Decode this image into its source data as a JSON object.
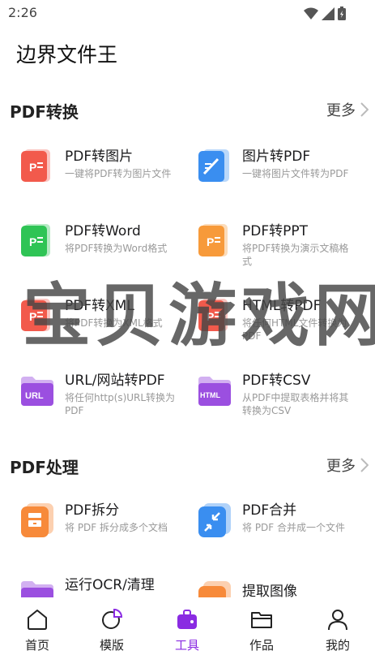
{
  "status": {
    "time": "2:26"
  },
  "app": {
    "title": "边界文件王"
  },
  "sections": [
    {
      "title": "PDF转换",
      "more": "更多",
      "tools": [
        {
          "name": "PDF转图片",
          "desc": "一键将PDF转为图片文件",
          "icon": "pdf-to-image-icon",
          "color": "#f25a4c",
          "badge": "P"
        },
        {
          "name": "图片转PDF",
          "desc": "一键将图片文件转为PDF",
          "icon": "image-to-pdf-icon",
          "color": "#3a8ef0",
          "badge": ""
        },
        {
          "name": "PDF转Word",
          "desc": "将PDF转换为Word格式",
          "icon": "pdf-to-word-icon",
          "color": "#2fc455",
          "badge": "P"
        },
        {
          "name": "PDF转PPT",
          "desc": "将PDF转换为演示文稿格式",
          "icon": "pdf-to-ppt-icon",
          "color": "#f79a3a",
          "badge": "P"
        },
        {
          "name": "PDF转XML",
          "desc": "将PDF转换为XML格式",
          "icon": "pdf-to-xml-icon",
          "color": "#f25a4c",
          "badge": "P"
        },
        {
          "name": "HTML转PDF",
          "desc": "将任何HTML文件转换为PDF",
          "icon": "html-to-pdf-icon",
          "color": "#f25a4c",
          "badge": "P"
        },
        {
          "name": "URL/网站转PDF",
          "desc": "将任何http(s)URL转换为PDF",
          "icon": "url-to-pdf-icon",
          "color": "#9b4fe0",
          "badge": "URL"
        },
        {
          "name": "PDF转CSV",
          "desc": "从PDF中提取表格并将其转换为CSV",
          "icon": "pdf-to-csv-icon",
          "color": "#9b4fe0",
          "badge": "HTML"
        }
      ]
    },
    {
      "title": "PDF处理",
      "more": "更多",
      "tools": [
        {
          "name": "PDF拆分",
          "desc": "将 PDF 拆分成多个文档",
          "icon": "pdf-split-icon",
          "color": "#f78a3a",
          "badge": ""
        },
        {
          "name": "PDF合并",
          "desc": "将 PDF 合并成一个文件",
          "icon": "pdf-merge-icon",
          "color": "#3a8ef0",
          "badge": ""
        },
        {
          "name": "运行OCR/清理",
          "desc": "",
          "icon": "ocr-icon",
          "color": "#9b4fe0",
          "badge": ""
        },
        {
          "name": "提取图像",
          "desc": "",
          "icon": "extract-image-icon",
          "color": "#f78a3a",
          "badge": ""
        }
      ]
    }
  ],
  "watermark": "宝贝游戏网",
  "tabs": [
    {
      "label": "首页",
      "icon": "home-icon"
    },
    {
      "label": "模版",
      "icon": "template-icon"
    },
    {
      "label": "工具",
      "icon": "toolbox-icon",
      "active": true
    },
    {
      "label": "作品",
      "icon": "folder-icon"
    },
    {
      "label": "我的",
      "icon": "user-icon"
    }
  ],
  "colors": {
    "accent": "#8a2be2",
    "text": "#1c1c1e",
    "muted": "#999999"
  }
}
